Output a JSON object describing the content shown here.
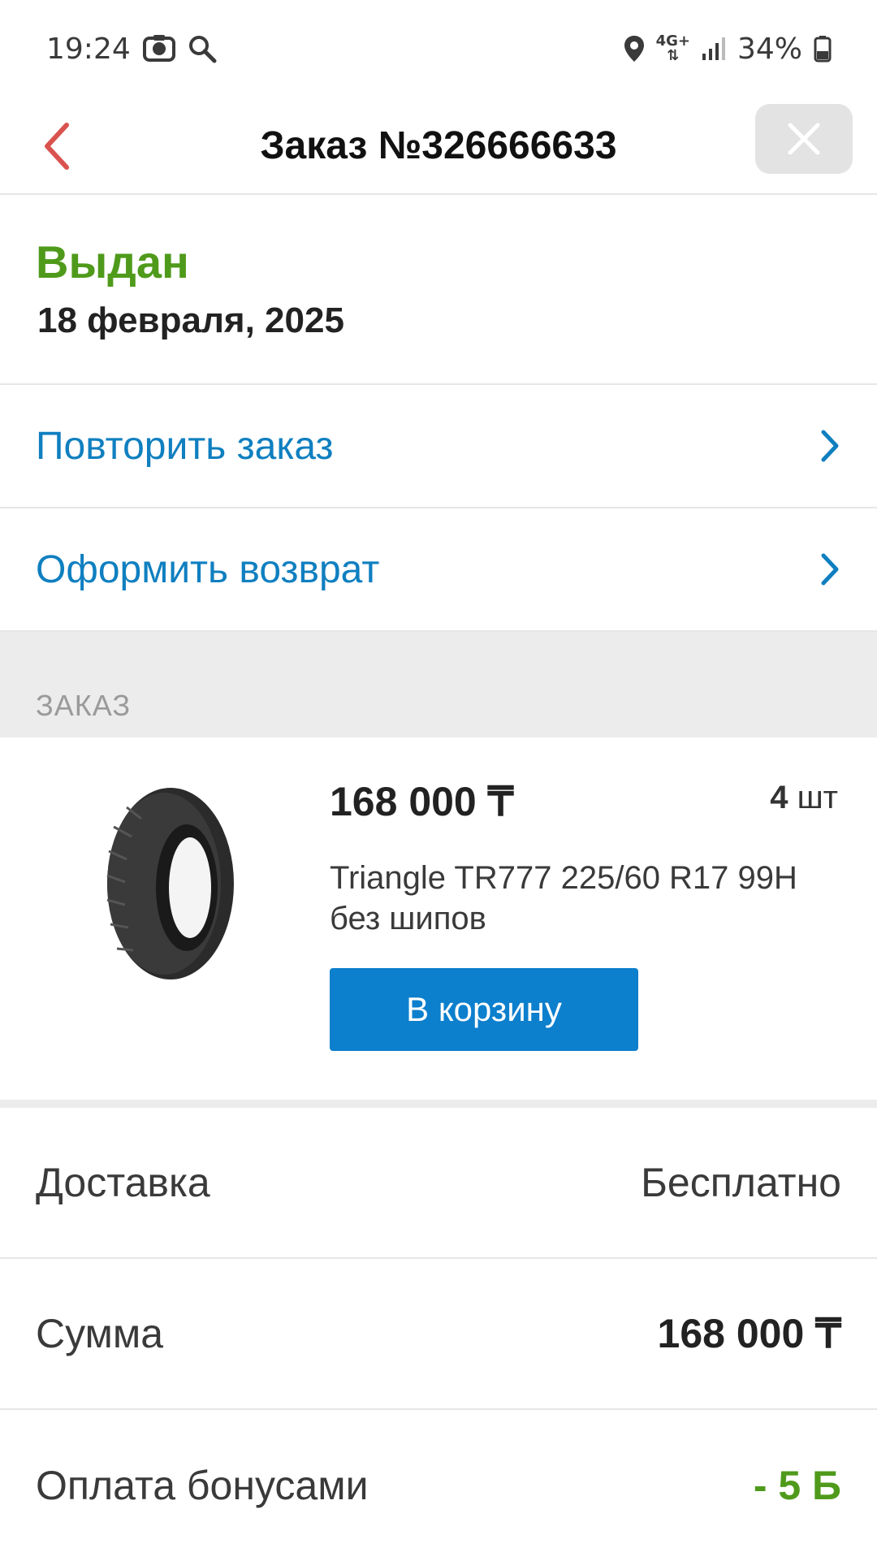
{
  "status_bar": {
    "time": "19:24",
    "network": "4G+",
    "battery": "34%"
  },
  "header": {
    "title": "Заказ №326666633"
  },
  "order_status": {
    "label": "Выдан",
    "date": "18 февраля, 2025"
  },
  "actions": [
    {
      "label": "Повторить заказ"
    },
    {
      "label": "Оформить возврат"
    }
  ],
  "section": {
    "label": "ЗАКАЗ"
  },
  "product": {
    "price": "168 000 ₸",
    "qty_number": "4",
    "qty_unit": "шт",
    "name": "Triangle TR777 225/60 R17 99H без шипов",
    "cart_button": "В корзину"
  },
  "summary": {
    "delivery_label": "Доставка",
    "delivery_value": "Бесплатно",
    "sum_label": "Сумма",
    "sum_value": "168 000 ₸",
    "bonus_label": "Оплата бонусами",
    "bonus_value": "- 5 Б"
  },
  "colors": {
    "accent_blue": "#0c7fcd",
    "link_blue": "#0f7fc0",
    "status_green": "#4f9a1b",
    "back_red": "#d9534f"
  }
}
